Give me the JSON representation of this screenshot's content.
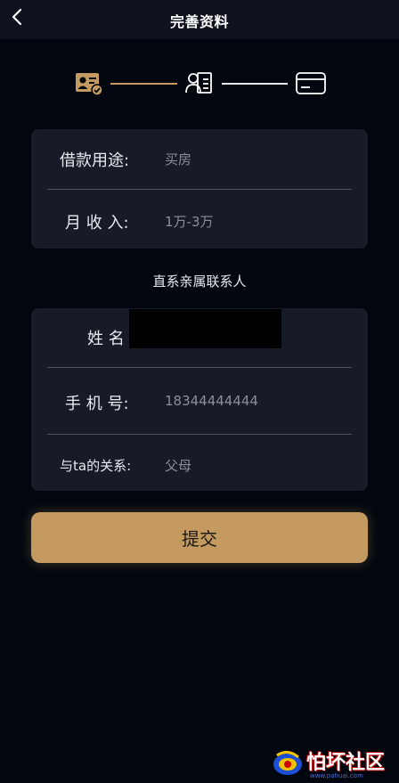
{
  "header": {
    "title": "完善资料"
  },
  "colors": {
    "accent": "#c49a61",
    "card_bg": "#161b27",
    "page_bg": "#02060e"
  },
  "steps": [
    {
      "icon": "id-card-check-icon",
      "state": "active"
    },
    {
      "icon": "person-list-icon",
      "state": "inactive"
    },
    {
      "icon": "bank-card-icon",
      "state": "inactive"
    }
  ],
  "loan_info": {
    "purpose_label": "借款用途:",
    "purpose_value": "买房",
    "income_label": "月 收 入:",
    "income_value": "1万-3万"
  },
  "contact_section_title": "直系亲属联系人",
  "contact": {
    "name_label": "姓 名",
    "phone_label": "手 机 号:",
    "phone_value": "18344444444",
    "relation_label": "与ta的关系:",
    "relation_value": "父母"
  },
  "submit_label": "提交",
  "watermark": {
    "text": "怕坏社区",
    "url": "www.pahuai.com"
  }
}
